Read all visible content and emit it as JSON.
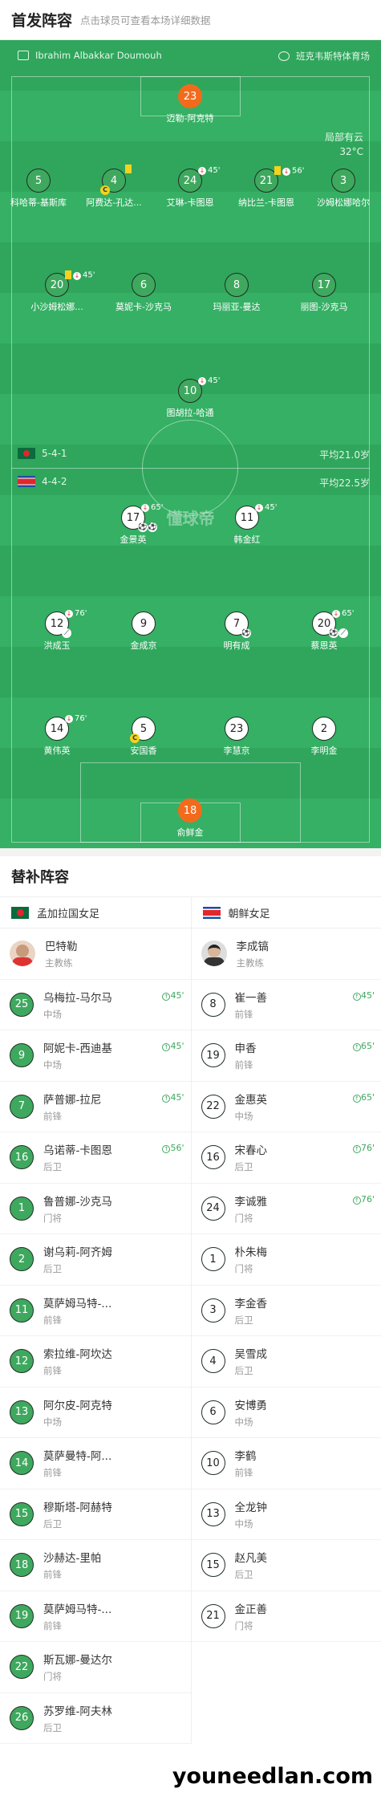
{
  "header": {
    "title": "首发阵容",
    "subtitle": "点击球员可查看本场详细数据"
  },
  "match": {
    "referee": "Ibrahim Albakkar Doumouh",
    "stadium": "班克韦斯特体育场",
    "weather": "局部有云",
    "temperature": "32°C",
    "watermark": "懂球帝"
  },
  "home": {
    "name": "孟加拉国女足",
    "formation": "5-4-1",
    "avg_age": "平均21.0岁",
    "flag_color": "#0a6b3d"
  },
  "away": {
    "name": "朝鲜女足",
    "formation": "4-4-2",
    "avg_age": "平均22.5岁",
    "flag_color": "#e1262c"
  },
  "home_lineup": [
    {
      "num": "23",
      "name": "迈勒-阿克特",
      "gk": true
    },
    {
      "num": "5",
      "name": "科哈蒂-基斯库"
    },
    {
      "num": "4",
      "name": "阿费达-孔达..."
    },
    {
      "num": "24",
      "name": "艾琳-卡图恩",
      "sub": "45'"
    },
    {
      "num": "21",
      "name": "纳比兰-卡图恩",
      "sub": "56'"
    },
    {
      "num": "3",
      "name": "沙姆松娜哈尔"
    },
    {
      "num": "20",
      "name": "小沙姆松娜...",
      "sub": "45'"
    },
    {
      "num": "6",
      "name": "莫妮卡-沙克马"
    },
    {
      "num": "8",
      "name": "玛丽亚-曼达"
    },
    {
      "num": "17",
      "name": "丽图-沙克马"
    },
    {
      "num": "10",
      "name": "图胡拉-哈通",
      "sub": "45'"
    }
  ],
  "away_lineup": [
    {
      "num": "17",
      "name": "金景英",
      "sub": "65'"
    },
    {
      "num": "11",
      "name": "韩金红",
      "sub": "45'"
    },
    {
      "num": "12",
      "name": "洪成玉",
      "sub": "76'"
    },
    {
      "num": "9",
      "name": "金成京"
    },
    {
      "num": "7",
      "name": "明有成"
    },
    {
      "num": "20",
      "name": "蔡恩英",
      "sub": "65'"
    },
    {
      "num": "14",
      "name": "黄伟英",
      "sub": "76'"
    },
    {
      "num": "5",
      "name": "安国香"
    },
    {
      "num": "23",
      "name": "李慧京"
    },
    {
      "num": "2",
      "name": "李明金"
    },
    {
      "num": "18",
      "name": "俞鲜金",
      "gk": true
    }
  ],
  "subs_title": "替补阵容",
  "home_coach": {
    "name": "巴特勒",
    "role": "主教练"
  },
  "away_coach": {
    "name": "李成镐",
    "role": "主教练"
  },
  "home_subs": [
    {
      "num": "25",
      "name": "乌梅拉-马尔马",
      "pos": "中场",
      "ev": "45'"
    },
    {
      "num": "9",
      "name": "阿妮卡-西迪基",
      "pos": "中场",
      "ev": "45'"
    },
    {
      "num": "7",
      "name": "萨普娜-拉尼",
      "pos": "前锋",
      "ev": "45'"
    },
    {
      "num": "16",
      "name": "乌诺蒂-卡图恩",
      "pos": "后卫",
      "ev": "56'"
    },
    {
      "num": "1",
      "name": "鲁普娜-沙克马",
      "pos": "门将"
    },
    {
      "num": "2",
      "name": "谢乌莉-阿齐姆",
      "pos": "后卫"
    },
    {
      "num": "11",
      "name": "莫萨姆马特-...",
      "pos": "前锋"
    },
    {
      "num": "12",
      "name": "索拉维-阿坎达",
      "pos": "前锋"
    },
    {
      "num": "13",
      "name": "阿尔皮-阿克特",
      "pos": "中场"
    },
    {
      "num": "14",
      "name": "莫萨曼特-阿...",
      "pos": "前锋"
    },
    {
      "num": "15",
      "name": "穆斯塔-阿赫特",
      "pos": "后卫"
    },
    {
      "num": "18",
      "name": "沙赫达-里帕",
      "pos": "前锋"
    },
    {
      "num": "19",
      "name": "莫萨姆马特-...",
      "pos": "前锋"
    },
    {
      "num": "22",
      "name": "斯瓦娜-曼达尔",
      "pos": "门将"
    },
    {
      "num": "26",
      "name": "苏罗维-阿夫林",
      "pos": "后卫"
    }
  ],
  "away_subs": [
    {
      "num": "8",
      "name": "崔一善",
      "pos": "前锋",
      "ev": "45'"
    },
    {
      "num": "19",
      "name": "申香",
      "pos": "前锋",
      "ev": "65'"
    },
    {
      "num": "22",
      "name": "金惠英",
      "pos": "中场",
      "ev": "65'"
    },
    {
      "num": "16",
      "name": "宋春心",
      "pos": "后卫",
      "ev": "76'"
    },
    {
      "num": "24",
      "name": "李诚雅",
      "pos": "门将",
      "ev": "76'"
    },
    {
      "num": "1",
      "name": "朴朱梅",
      "pos": "门将"
    },
    {
      "num": "3",
      "name": "李金香",
      "pos": "后卫"
    },
    {
      "num": "4",
      "name": "吴雪成",
      "pos": "后卫"
    },
    {
      "num": "6",
      "name": "安博勇",
      "pos": "中场"
    },
    {
      "num": "10",
      "name": "李鹤",
      "pos": "前锋"
    },
    {
      "num": "13",
      "name": "全龙钟",
      "pos": "中场"
    },
    {
      "num": "15",
      "name": "赵凡美",
      "pos": "后卫"
    },
    {
      "num": "21",
      "name": "金正善",
      "pos": "门将"
    }
  ],
  "footer_watermark": "youneedlan.com"
}
